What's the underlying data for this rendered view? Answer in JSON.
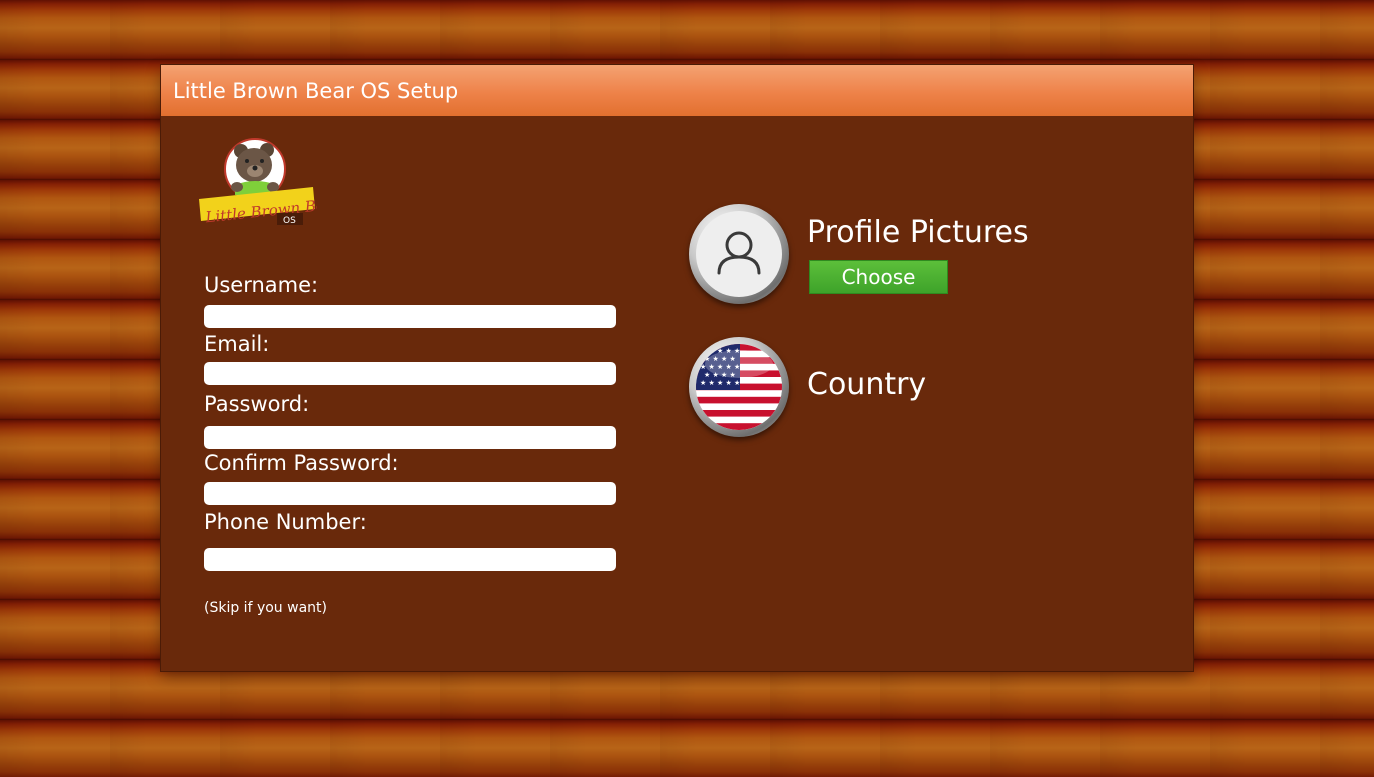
{
  "window": {
    "title": "Little Brown Bear OS Setup"
  },
  "logo": {
    "text": "Little Brown Bear",
    "badge": "OS"
  },
  "form": {
    "username_label": "Username:",
    "email_label": "Email:",
    "password_label": "Password:",
    "confirm_password_label": "Confirm Password:",
    "phone_label": "Phone Number:",
    "note": "(Skip if you want)",
    "username_value": "",
    "email_value": "",
    "password_value": "",
    "confirm_password_value": "",
    "phone_value": ""
  },
  "profile": {
    "title": "Profile Pictures",
    "choose_label": "Choose",
    "icon": "user-icon"
  },
  "country": {
    "title": "Country",
    "flag": "us-flag-icon"
  },
  "colors": {
    "window_bg": "#69290b",
    "titlebar": "#ee8249",
    "choose_button": "#4cb034",
    "text": "#ffffff"
  }
}
